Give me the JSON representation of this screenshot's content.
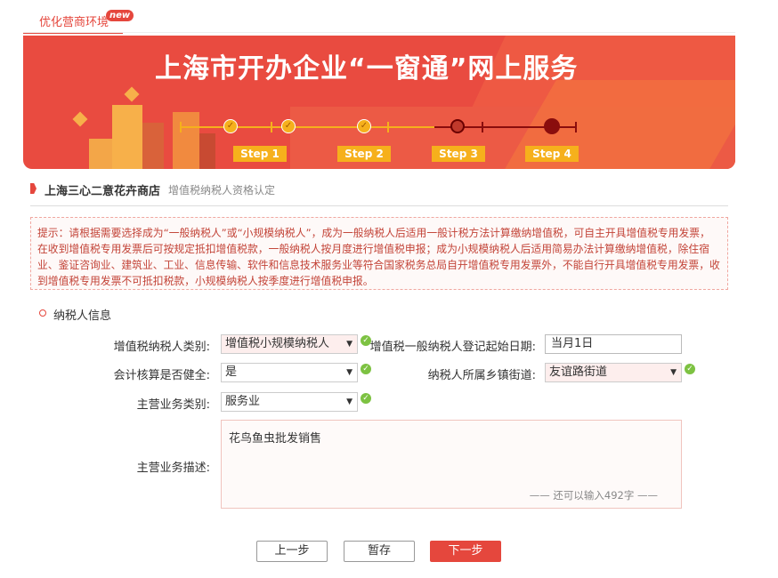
{
  "top_tab": {
    "label": "优化营商环境",
    "badge": "new"
  },
  "banner": {
    "title": "上海市开办企业“一窗通”网上服务",
    "steps": [
      "Step 1",
      "Step 2",
      "Step 3",
      "Step 4"
    ],
    "current_step": 3
  },
  "breadcrumb": {
    "company": "上海三心二意花卉商店",
    "subtitle": "增值税纳税人资格认定"
  },
  "notice": "提示：请根据需要选择成为“一般纳税人”或“小规模纳税人”，成为一般纳税人后适用一般计税方法计算缴纳增值税，可自主开具增值税专用发票，在收到增值税专用发票后可按规定抵扣增值税款，一般纳税人按月度进行增值税申报；成为小规模纳税人后适用简易办法计算缴纳增值税，除住宿业、鉴证咨询业、建筑业、工业、信息传输、软件和信息技术服务业等符合国家税务总局自开增值税专用发票外，不能自行开具增值税专用发票，收到增值税专用发票不可抵扣税款，小规模纳税人按季度进行增值税申报。",
  "section_title": "纳税人信息",
  "form": {
    "vat_type_label": "增值税纳税人类别:",
    "vat_type_value": "增值税小规模纳税人",
    "reg_date_label": "增值税一般纳税人登记起始日期:",
    "reg_date_value": "当月1日",
    "accounting_label": "会计核算是否健全:",
    "accounting_value": "是",
    "street_label": "纳税人所属乡镇街道:",
    "street_value": "友谊路街道",
    "biz_type_label": "主营业务类别:",
    "biz_type_value": "服务业",
    "biz_desc_label": "主营业务描述:",
    "biz_desc_value": "花鸟鱼虫批发销售",
    "biz_desc_hint": "—— 还可以输入492字 ——"
  },
  "buttons": {
    "prev": "上一步",
    "save": "暂存",
    "next": "下一步"
  },
  "colors": {
    "accent": "#e5473d",
    "step_done": "#f6b01c",
    "ok": "#7dc242"
  }
}
